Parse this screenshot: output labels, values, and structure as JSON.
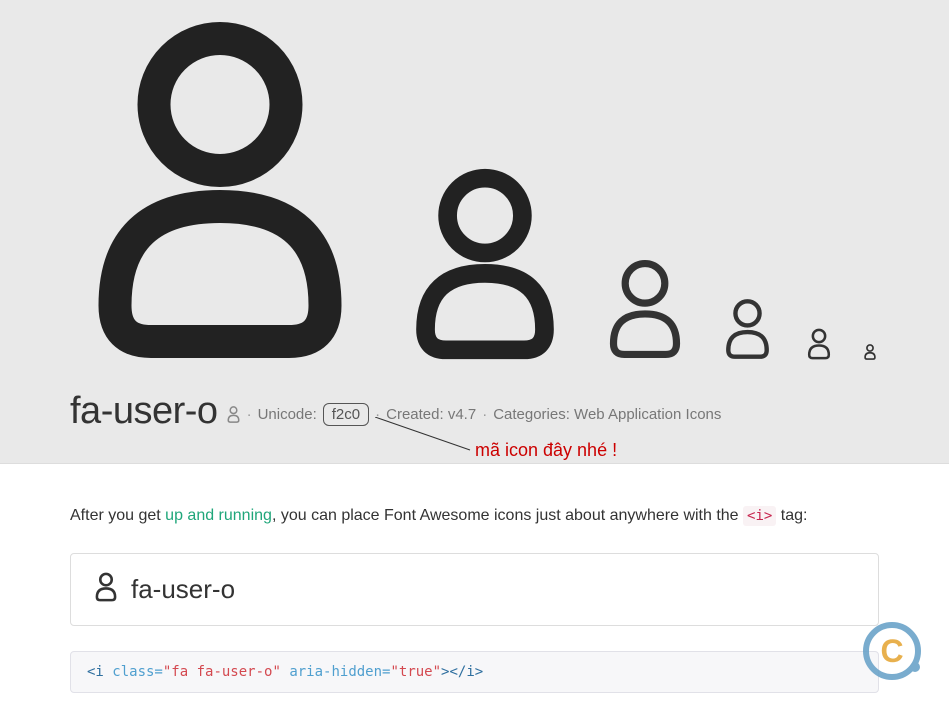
{
  "header": {
    "title": "fa-user-o",
    "unicode_label": "Unicode:",
    "unicode_value": "f2c0",
    "created_label": "Created: v4.7",
    "categories_label": "Categories: Web Application Icons"
  },
  "annotation": {
    "text": "mã icon đây nhé !"
  },
  "intro": {
    "before_link": "After you get ",
    "link_text": "up and running",
    "after_link": ", you can place Font Awesome icons just about anywhere with the ",
    "code_tag": "<i>",
    "after_code": " tag:"
  },
  "example": {
    "label": "fa-user-o"
  },
  "code": {
    "open_tag": "<i",
    "class_attr": " class=",
    "class_val": "\"fa fa-user-o\"",
    "aria_attr": " aria-hidden=",
    "aria_val": "\"true\"",
    "close": "></i>"
  }
}
